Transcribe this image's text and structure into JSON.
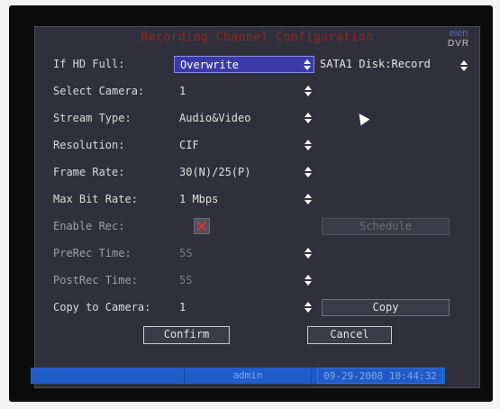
{
  "dialog": {
    "title": "Recording Channel Configuration",
    "logo_top": "eien",
    "logo_bottom": "DVR"
  },
  "rows": {
    "hd_full": {
      "label": "If HD Full:",
      "value": "Overwrite"
    },
    "disk": {
      "label": "SATA1 Disk:",
      "value": "Record"
    },
    "camera": {
      "label": "Select Camera:",
      "value": "1"
    },
    "stream": {
      "label": "Stream Type:",
      "value": "Audio&Video"
    },
    "resolution": {
      "label": "Resolution:",
      "value": "CIF"
    },
    "frame_rate": {
      "label": "Frame Rate:",
      "value": "30(N)/25(P)"
    },
    "max_bit_rate": {
      "label": "Max Bit Rate:",
      "value": "1 Mbps"
    },
    "enable_rec": {
      "label": "Enable Rec:",
      "checked": false,
      "schedule_label": "Schedule"
    },
    "prerec": {
      "label": "PreRec Time:",
      "value": "5S"
    },
    "postrec": {
      "label": "PostRec Time:",
      "value": "5S"
    },
    "copy_to": {
      "label": "Copy to Camera:",
      "value": "1",
      "copy_label": "Copy"
    }
  },
  "buttons": {
    "confirm": "Confirm",
    "cancel": "Cancel"
  },
  "status": {
    "user": "admin",
    "datetime": "09-29-2008 10:44:32"
  },
  "colors": {
    "dialog_bg": "#30303c",
    "active_field": "#3a3aa8",
    "status_bar": "#1f5cc8",
    "title": "#8a2a2a",
    "checkbox_x": "#d23a3a"
  },
  "icons": {
    "spinner": "up-down-arrows-icon",
    "checkbox_mark": "x-mark-icon",
    "cursor": "mouse-pointer-icon"
  }
}
